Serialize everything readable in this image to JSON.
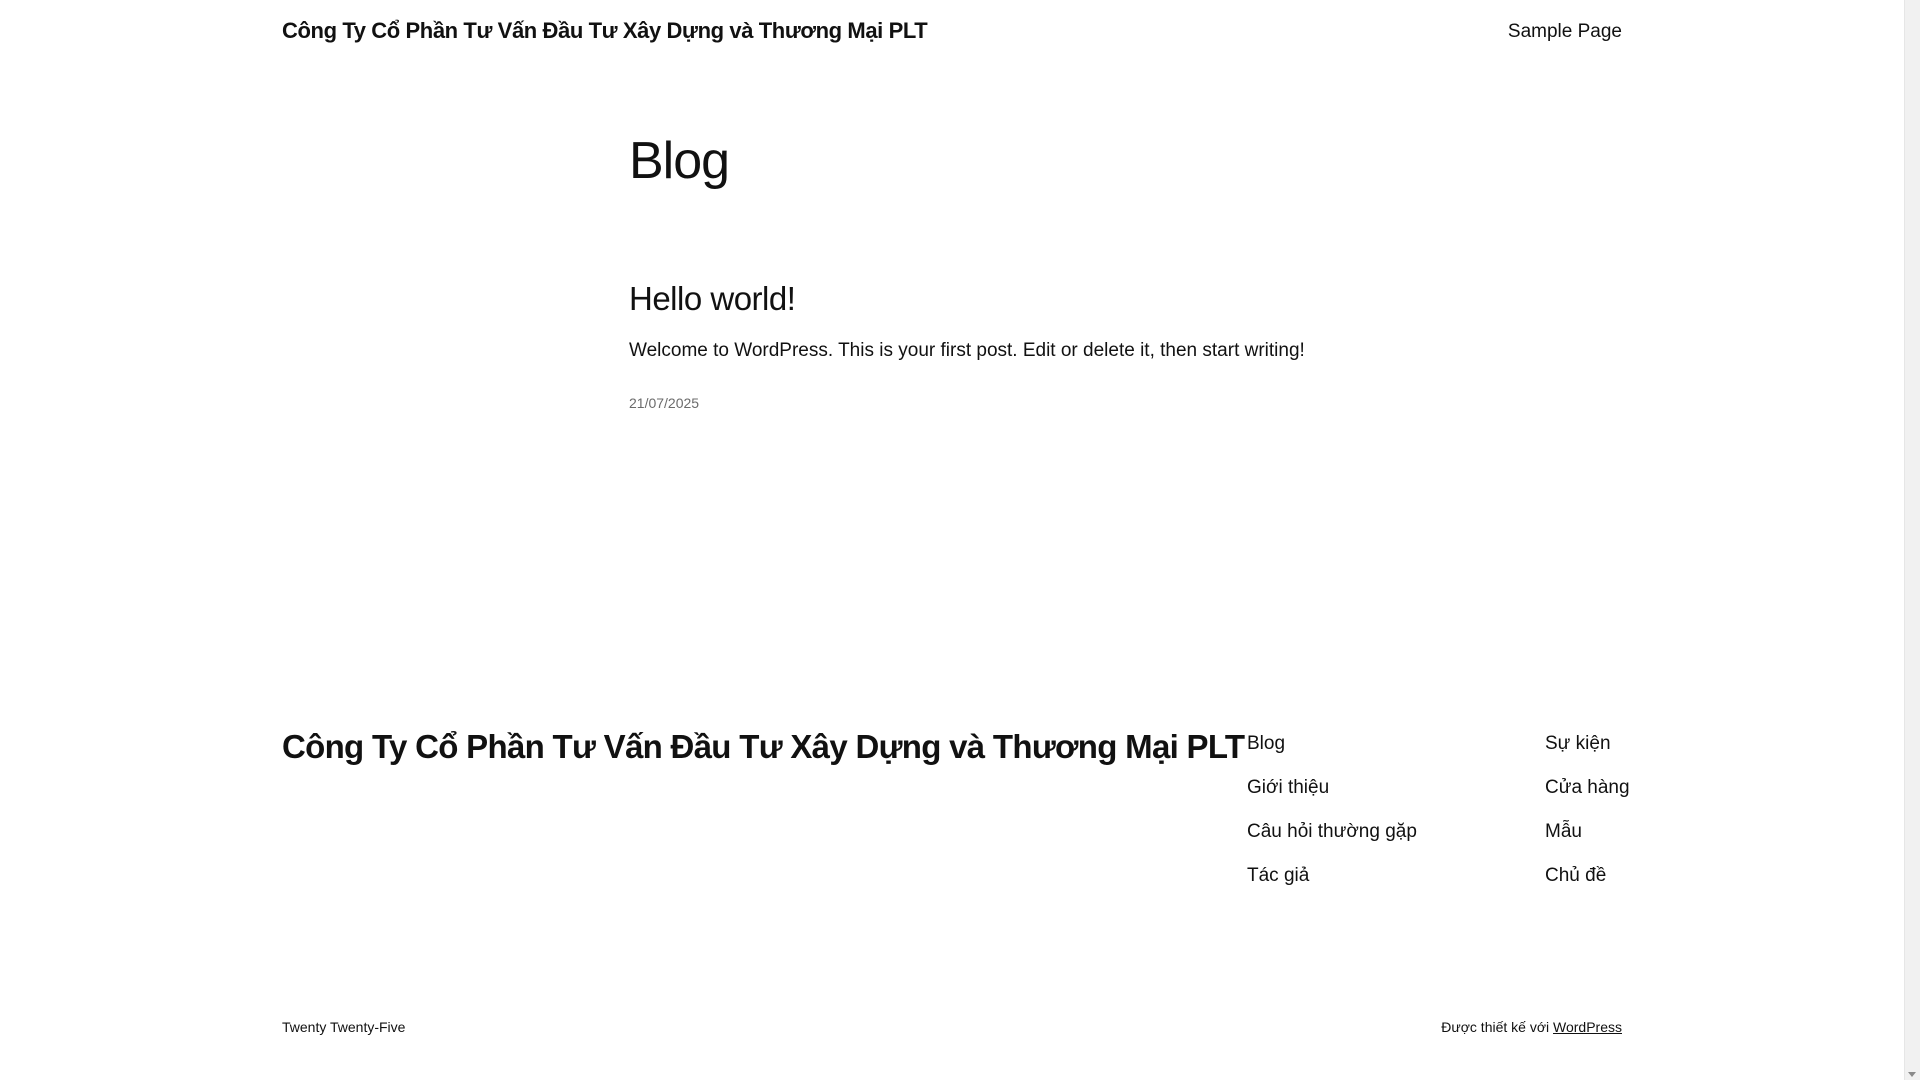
{
  "header": {
    "site_title": "Công Ty Cổ Phần Tư Vấn Đầu Tư Xây Dựng và Thương Mại PLT",
    "nav_item": "Sample Page"
  },
  "main": {
    "heading": "Blog",
    "post": {
      "title": "Hello world!",
      "excerpt": "Welcome to WordPress. This is your first post. Edit or delete it, then start writing!",
      "date": "21/07/2025"
    }
  },
  "footer": {
    "site_title": "Công Ty Cổ Phần Tư Vấn Đầu Tư Xây Dựng và Thương Mại PLT",
    "col1": [
      "Blog",
      "Giới thiệu",
      "Câu hỏi thường gặp",
      "Tác giả"
    ],
    "col2": [
      "Sự kiện",
      "Cửa hàng",
      "Mẫu",
      "Chủ đề"
    ],
    "theme_credit": "Twenty Twenty-Five",
    "designed_by": "Được thiết kế với",
    "wordpress_link": "WordPress"
  },
  "icons": {
    "scroll_down": "chevron-down-icon"
  }
}
